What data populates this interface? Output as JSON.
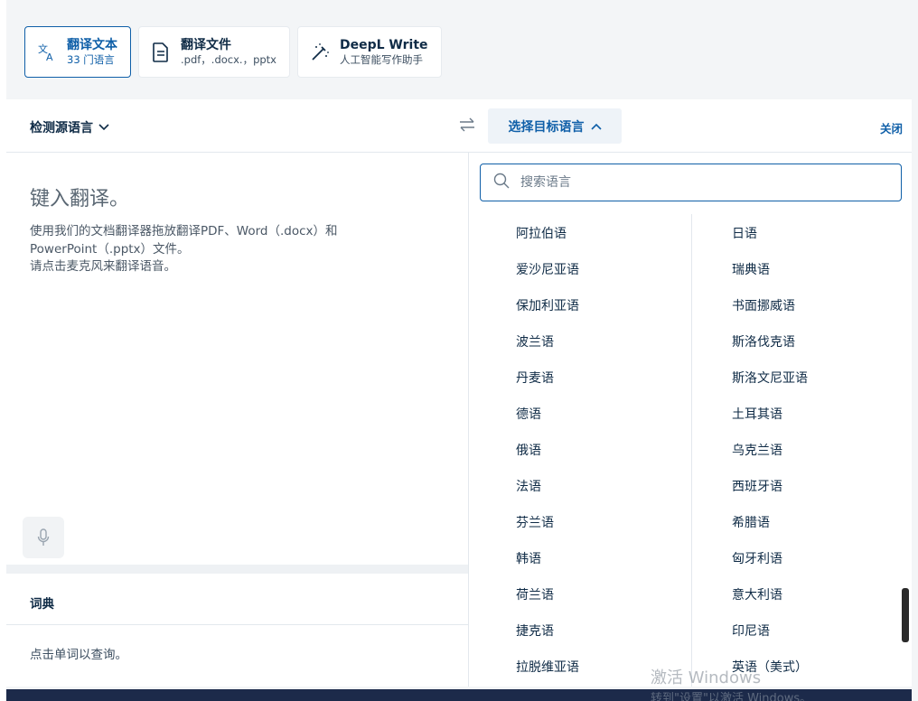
{
  "modes": [
    {
      "title": "翻译文本",
      "subtitle": "33 门语言",
      "icon": "translate-icon",
      "active": true
    },
    {
      "title": "翻译文件",
      "subtitle": ".pdf，.docx.，pptx",
      "icon": "document-icon",
      "active": false
    },
    {
      "title": "DeepL Write",
      "subtitle": "人工智能写作助手",
      "icon": "magic-pen-icon",
      "active": false
    }
  ],
  "langbar": {
    "source_label": "检测源语言",
    "target_label": "选择目标语言",
    "close_label": "关闭"
  },
  "source": {
    "placeholder": "键入翻译。",
    "hint_line1": "使用我们的文档翻译器拖放翻译PDF、Word（.docx）和",
    "hint_line2": "PowerPoint（.pptx）文件。",
    "hint_line3": "请点击麦克风来翻译语音。"
  },
  "dictionary": {
    "title": "词典",
    "hint": "点击单词以查询。"
  },
  "search": {
    "placeholder": "搜索语言"
  },
  "languages_col1": [
    "阿拉伯语",
    "爱沙尼亚语",
    "保加利亚语",
    "波兰语",
    "丹麦语",
    "德语",
    "俄语",
    "法语",
    "芬兰语",
    "韩语",
    "荷兰语",
    "捷克语",
    "拉脱维亚语"
  ],
  "languages_col2": [
    "日语",
    "瑞典语",
    "书面挪威语",
    "斯洛伐克语",
    "斯洛文尼亚语",
    "土耳其语",
    "乌克兰语",
    "西班牙语",
    "希腊语",
    "匈牙利语",
    "意大利语",
    "印尼语",
    "英语（美式）"
  ],
  "watermark": {
    "line1": "激活 Windows",
    "line2": "转到\"设置\"以激活 Windows。"
  },
  "colors": {
    "accent": "#0f5fa8",
    "text": "#0f2b46",
    "bg": "#f3f5f7"
  }
}
